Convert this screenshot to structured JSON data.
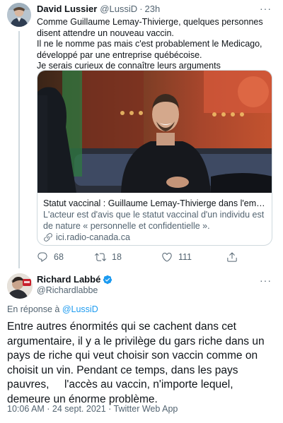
{
  "tweet1": {
    "name": "David Lussier",
    "handle": "@LussiD",
    "separator": "·",
    "time": "23h",
    "more": "···",
    "text_lines": [
      "Comme Guillaume Lemay-Thivierge, quelques personnes",
      "disent attendre un nouveau vaccin.",
      "Il ne le nomme pas mais c'est probablement le Medicago,",
      "développé par une entreprise québécoise.",
      "Je serais curieux de connaître leurs arguments"
    ],
    "card": {
      "title": "Statut vaccinal : Guillaume Lemay-Thivierge dans l'embar…",
      "desc_lines": [
        "L'acteur est d'avis que le statut vaccinal d'un individu est",
        "de nature « personnelle et confidentielle »."
      ],
      "domain": "ici.radio-canada.ca",
      "domain_icon": "link-icon"
    },
    "actions": {
      "replies": "68",
      "retweets": "18",
      "likes": "111"
    }
  },
  "tweet2": {
    "name": "Richard Labbé",
    "verified_icon": "verified-badge-icon",
    "handle": "@Richardlabbe",
    "more": "···",
    "reply_prefix": "En réponse à",
    "reply_handle": "@LussiD",
    "text_lines": [
      "Entre autres énormités qui se cachent dans cet",
      "argumentaire, il y a le privilège du gars riche dans un",
      "pays de riche qui veut choisir son vaccin comme on",
      "choisit un vin. Pendant ce temps, dans les pays",
      "pauvres,     l'accès au vaccin, n'importe lequel,",
      "demeure un énorme problème."
    ],
    "meta": "10:06 AM · 24 sept. 2021 · Twitter Web App"
  },
  "colors": {
    "text": "#0f1419",
    "secondary": "#536471",
    "accent": "#1d9bf0",
    "border": "#cfd9de"
  }
}
